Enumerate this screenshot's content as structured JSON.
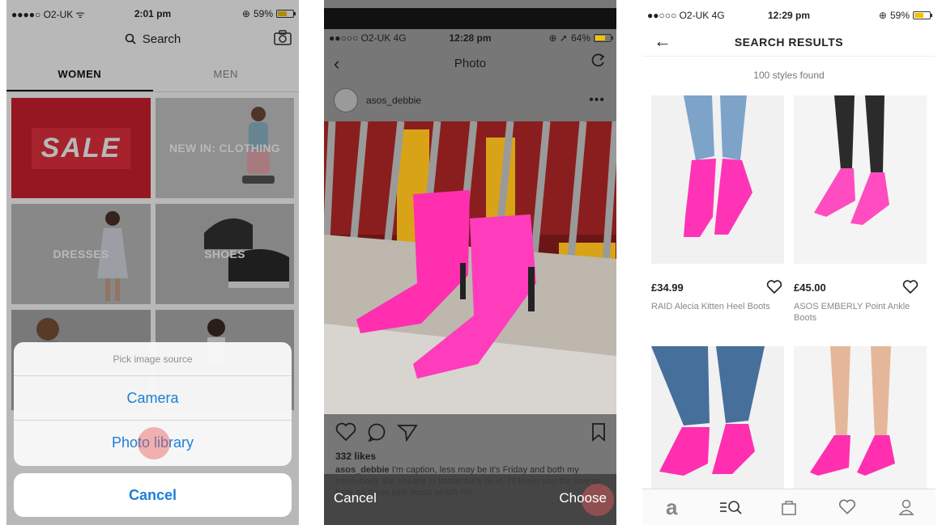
{
  "phone1": {
    "status": {
      "carrier": "●●●●○ O2-UK ᯤ",
      "time": "2:01 pm",
      "battery": "59%"
    },
    "search_label": "Search",
    "tabs": [
      {
        "label": "WOMEN",
        "active": true
      },
      {
        "label": "MEN",
        "active": false
      }
    ],
    "tiles": {
      "sale": "SALE",
      "new_in": "NEW IN: CLOTHING",
      "dresses": "DRESSES",
      "shoes": "SHOES"
    },
    "sheet": {
      "title": "Pick image source",
      "camera": "Camera",
      "photo_library": "Photo library",
      "cancel": "Cancel"
    }
  },
  "phone2": {
    "status": {
      "carrier": "●●○○○ O2-UK  4G",
      "time": "12:28 pm",
      "battery": "64%"
    },
    "nav_title": "Photo",
    "username": "asos_debbie",
    "more": "•••",
    "likes": "332 likes",
    "caption_user": "asos_debbie",
    "caption_text": "I'm caption, less may be it's Friday and both my mind+body are already in tomorrow's lie-in. I'll leave you the love or hate on these pink boots which I'm",
    "bottom_cancel": "Cancel",
    "bottom_choose": "Choose"
  },
  "phone3": {
    "status": {
      "carrier": "●●○○○ O2-UK  4G",
      "time": "12:29 pm",
      "battery": "59%"
    },
    "title": "SEARCH RESULTS",
    "found": "100 styles found",
    "products": [
      {
        "price": "£34.99",
        "name": "RAID Alecia Kitten Heel Boots"
      },
      {
        "price": "£45.00",
        "name": "ASOS EMBERLY Point Ankle Boots"
      },
      {
        "price": "",
        "name": ""
      },
      {
        "price": "",
        "name": ""
      }
    ]
  },
  "colors": {
    "accent_blue": "#1b7fd6",
    "sale_red": "#d0202f",
    "boot_pink": "#ff2fb0"
  }
}
